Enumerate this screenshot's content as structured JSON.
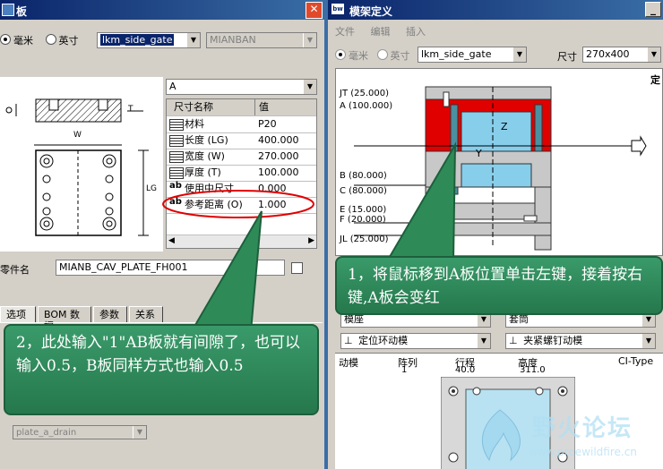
{
  "left_window": {
    "title": "板",
    "units": {
      "mm": "毫米",
      "inch": "英寸",
      "selected": "mm"
    },
    "catalog_value": "lkm_side_gate",
    "type_value": "MIANBAN",
    "diagram_labels": {
      "w": "W",
      "t": "T",
      "lg": "LG"
    },
    "dim_select": "A",
    "grid": {
      "headers": [
        "尺寸名称",
        "值"
      ],
      "rows": [
        {
          "icon": "grid",
          "name": "材料",
          "value": "P20"
        },
        {
          "icon": "grid",
          "name": "长度 (LG)",
          "value": "400.000"
        },
        {
          "icon": "grid",
          "name": "宽度 (W)",
          "value": "270.000"
        },
        {
          "icon": "grid",
          "name": "厚度 (T)",
          "value": "100.000"
        },
        {
          "icon": "ab",
          "name": "使用中尺寸",
          "value": "0.000"
        },
        {
          "icon": "ab",
          "name": "参考距离 (O)",
          "value": "1.000"
        }
      ]
    },
    "part_name_label": "零件名",
    "part_name_value": "MIANB_CAV_PLATE_FH001",
    "tabs": [
      "选项",
      "BOM 数据",
      "参数",
      "关系"
    ],
    "bottom_field": "plate_a_drain"
  },
  "right_window": {
    "title": "模架定义",
    "menu": [
      "文件",
      "编辑",
      "插入"
    ],
    "units": {
      "mm": "毫米",
      "inch": "英寸",
      "selected": "mm"
    },
    "catalog_value": "lkm_side_gate",
    "size_label": "尺寸",
    "size_value": "270x400",
    "top_right_label": "定",
    "plate_labels": [
      "JT (25.000)",
      "A (100.000)",
      "B (80.000)",
      "C (80.000)",
      "E (15.000)",
      "F (20.000)",
      "JL (25.000)"
    ],
    "section_letters": {
      "z": "Z",
      "y": "Y"
    },
    "row_selects": [
      {
        "left": "模座",
        "right": "套筒"
      },
      {
        "left": "定位环动模",
        "right": "夹紧螺钉动模"
      }
    ],
    "info_headers": [
      "动模",
      "阵列",
      "行程",
      "高度",
      "CI-Type"
    ],
    "info_values": [
      "1",
      "40.0",
      "311.0"
    ]
  },
  "callouts": {
    "right": "1，将鼠标移到A板位置单击左键，接着按右键,A板会变红",
    "left": "2，此处输入\"1\"AB板就有间隙了，也可以输入0.5，B板同样方式也输入0.5"
  },
  "watermark": {
    "title": "野火论坛",
    "url": "www.proewildfire.cn"
  },
  "colors": {
    "title_bar": "#0a246a",
    "close_button": "#e04a2a",
    "callout": "#2e8b57",
    "a_plate": "#e00000",
    "cavity": "#87ceeb",
    "highlight_ellipse": "#e00000"
  }
}
